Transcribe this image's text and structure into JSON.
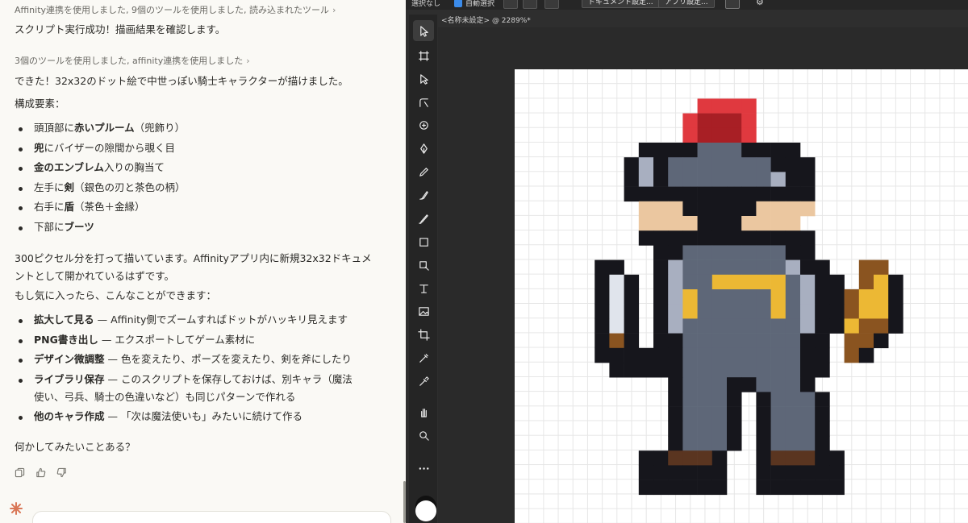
{
  "chat": {
    "tool_line_1": "Affinity連携を使用しました, 9個のツールを使用しました, 読み込まれたツール",
    "chevron": "›",
    "result_1": "スクリプト実行成功！描画結果を確認します。",
    "tool_line_2": "3個のツールを使用しました, affinity連携を使用しました",
    "result_2": "できた！32x32のドット絵で中世っぽい騎士キャラクターが描けました。",
    "components_heading": "構成要素：",
    "components": [
      {
        "pre": "頭頂部に",
        "bold": "赤いプルーム",
        "post": "（兜飾り）"
      },
      {
        "pre": "",
        "bold": "兜",
        "post": "にバイザーの隙間から覗く目"
      },
      {
        "pre": "",
        "bold": "金のエンブレム",
        "post": "入りの胸当て"
      },
      {
        "pre": "左手に",
        "bold": "剣",
        "post": "（銀色の刃と茶色の柄）"
      },
      {
        "pre": "右手に",
        "bold": "盾",
        "post": "（茶色＋金縁）"
      },
      {
        "pre": "下部に",
        "bold": "ブーツ",
        "post": ""
      }
    ],
    "pixel_note": "300ピクセル分を打って描いています。Affinityアプリ内に新規32x32ドキュメントとして開かれているはずです。",
    "options_heading": "もし気に入ったら、こんなことができます：",
    "options": [
      {
        "bold": "拡大して見る",
        "post": " — Affinity側でズームすればドットがハッキリ見えます"
      },
      {
        "bold": "PNG書き出し",
        "post": " — エクスポートしてゲーム素材に"
      },
      {
        "bold": "デザイン微調整",
        "post": " — 色を変えたり、ポーズを変えたり、剣を斧にしたり"
      },
      {
        "bold": "ライブラリ保存",
        "post": " — このスクリプトを保存しておけば、別キャラ（魔法使い、弓兵、騎士の色違いなど）も同じパターンで作れる"
      },
      {
        "bold": "他のキャラ作成",
        "post": " — 「次は魔法使いも」みたいに続けて作る"
      }
    ],
    "closing_question": "何かしてみたいことある？",
    "action_icons": [
      "copy-icon",
      "thumbs-up-icon",
      "thumbs-down-icon"
    ]
  },
  "affinity": {
    "selection_label": "選択なし",
    "auto_select_label": "自動選択",
    "document_settings_button": "ドキュメント設定...",
    "app_settings_button": "アプリ設定...",
    "document_tab": "<名称未設定> @ 2289%*",
    "tools": [
      "move-tool-icon",
      "artboard-tool-icon",
      "node-tool-icon",
      "corner-tool-icon",
      "vector-crop-tool-icon",
      "pen-tool-icon",
      "pencil-tool-icon",
      "vector-brush-tool-icon",
      "paint-brush-tool-icon",
      "rectangle-tool-icon",
      "selection-brush-tool-icon",
      "frame-text-tool-icon",
      "image-tool-icon",
      "crop-tool-icon",
      "eyedropper-tool-icon",
      "color-picker-tool-icon",
      "hand-tool-icon",
      "zoom-tool-icon",
      "more-tools-icon"
    ],
    "colors": {
      "outline": "#16161c",
      "armor": "#5e6778",
      "armor_light": "#a8afc0",
      "gold": "#ecb834",
      "skin": "#ebc7a0",
      "plume": "#e0393f",
      "plume_dark": "#a81f25",
      "brown": "#8a5420",
      "boot": "#5a3520",
      "blade": "#e0e4ec"
    }
  }
}
